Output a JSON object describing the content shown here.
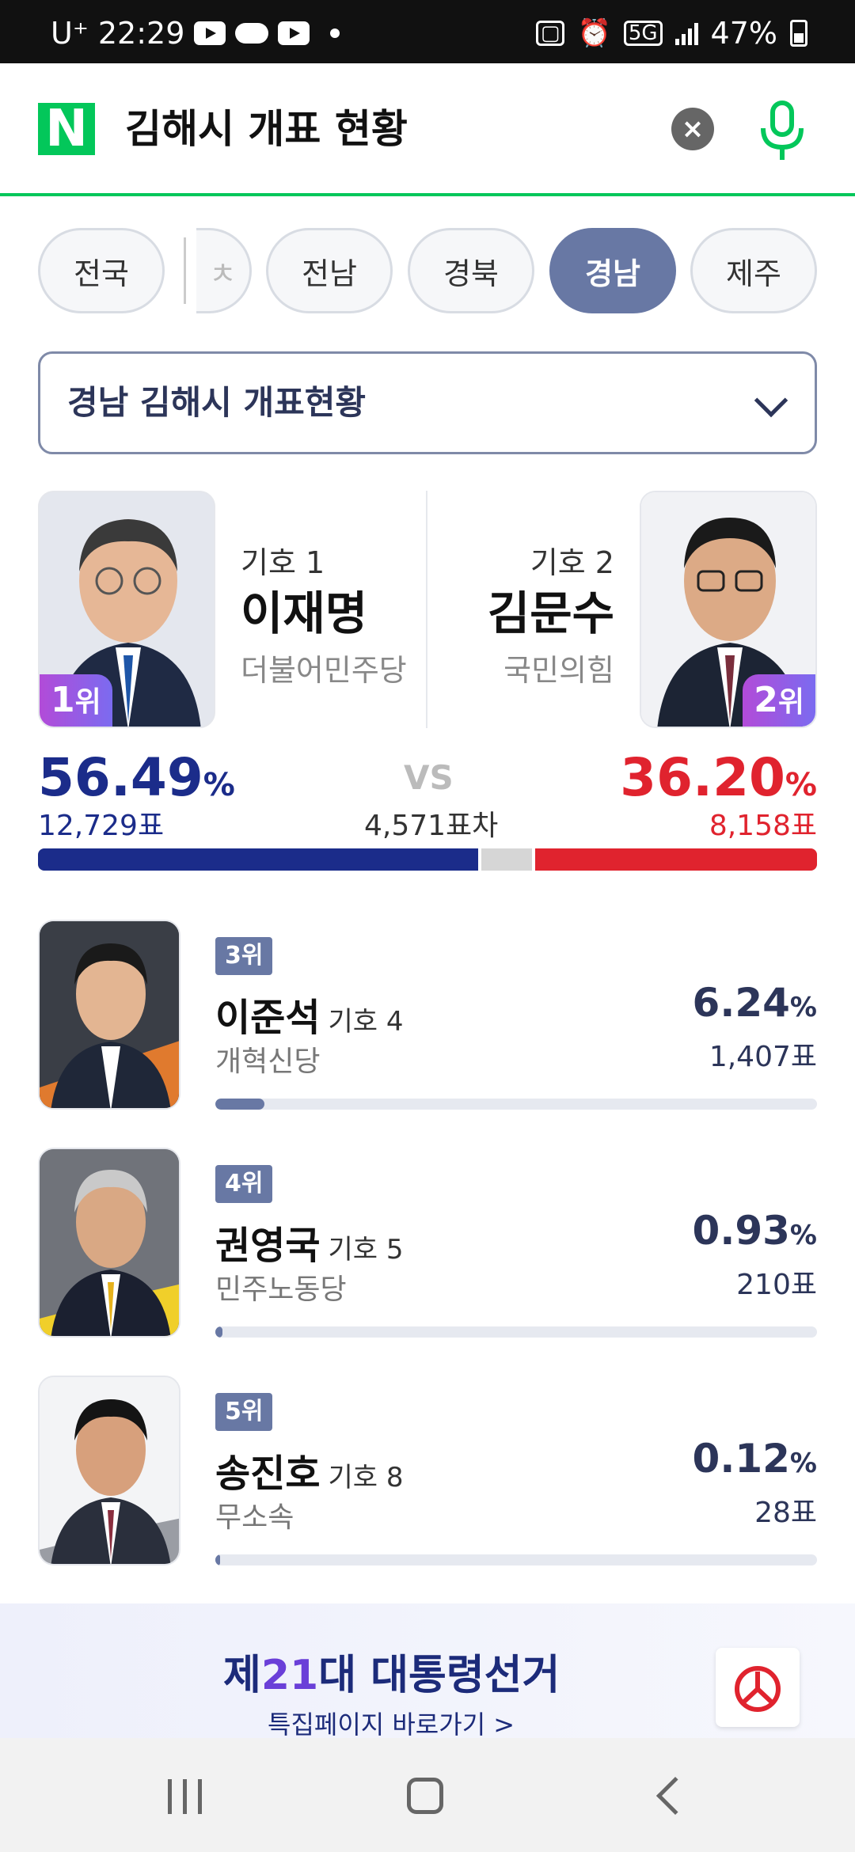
{
  "status_bar": {
    "carrier": "U⁺",
    "time": "22:29",
    "network": "5G",
    "battery": "47%"
  },
  "search": {
    "logo": "N",
    "query": "김해시 개표 현황",
    "clear_icon": "close-icon",
    "mic_icon": "mic-icon"
  },
  "region_tabs": {
    "items": [
      "전국",
      "전남",
      "경북",
      "경남",
      "제주"
    ],
    "active": "경남",
    "partial": "ㅊ"
  },
  "dropdown": {
    "label": "경남 김해시 개표현황"
  },
  "top_candidates": {
    "first": {
      "number": "기호 1",
      "name": "이재명",
      "party": "더불어민주당",
      "rank": "1",
      "rank_suffix": "위",
      "percent": "56.49",
      "votes": "12,729표",
      "color": "#1b2c8a"
    },
    "second": {
      "number": "기호 2",
      "name": "김문수",
      "party": "국민의힘",
      "rank": "2",
      "rank_suffix": "위",
      "percent": "36.20",
      "votes": "8,158표",
      "color": "#e0232e"
    },
    "vs": "VS",
    "diff": "4,571표차",
    "percent_sign": "%"
  },
  "others": [
    {
      "rank": "3위",
      "name": "이준석",
      "number": "기호 4",
      "party": "개혁신당",
      "percent": "6.24",
      "votes": "1,407표",
      "share": 0.0624
    },
    {
      "rank": "4위",
      "name": "권영국",
      "number": "기호 5",
      "party": "민주노동당",
      "percent": "0.93",
      "votes": "210표",
      "share": 0.0093
    },
    {
      "rank": "5위",
      "name": "송진호",
      "number": "기호 8",
      "party": "무소속",
      "percent": "0.12",
      "votes": "28표",
      "share": 0.0012
    }
  ],
  "banner": {
    "title_pre": "제",
    "title_num": "21",
    "title_post": "대 대통령선거",
    "subtitle": "특집페이지 바로가기 >"
  },
  "colors": {
    "naver_green": "#03c75a",
    "accent": "#6878a4",
    "navy": "#2c3559"
  }
}
